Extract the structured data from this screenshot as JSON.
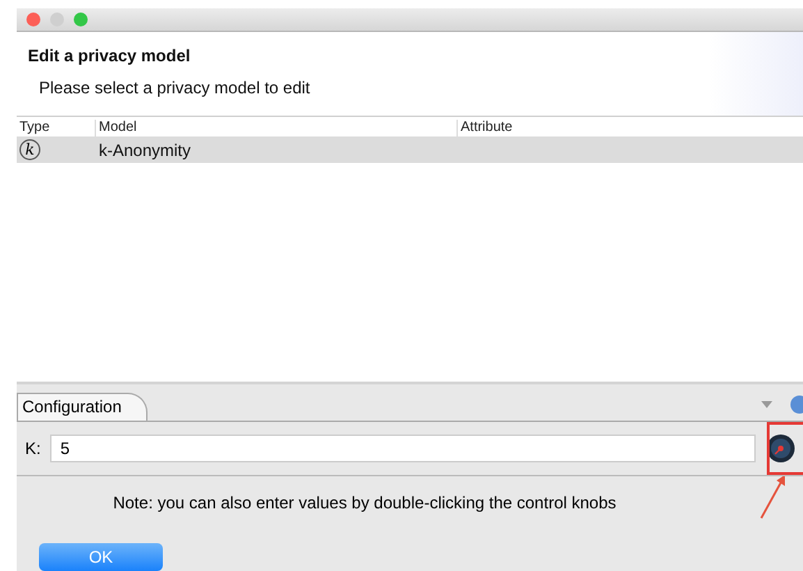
{
  "header": {
    "title": "Edit a privacy model",
    "subtitle": "Please select a privacy model to edit"
  },
  "table": {
    "columns": [
      "Type",
      "Model",
      "Attribute"
    ],
    "rows": [
      {
        "type_symbol": "k",
        "model": "k-Anonymity",
        "selected": true
      }
    ]
  },
  "configuration": {
    "tab": "Configuration",
    "field_label": "K:",
    "field_value": "5",
    "note": "Note: you can also enter values by double-clicking the control knobs"
  },
  "buttons": [
    "OK"
  ]
}
